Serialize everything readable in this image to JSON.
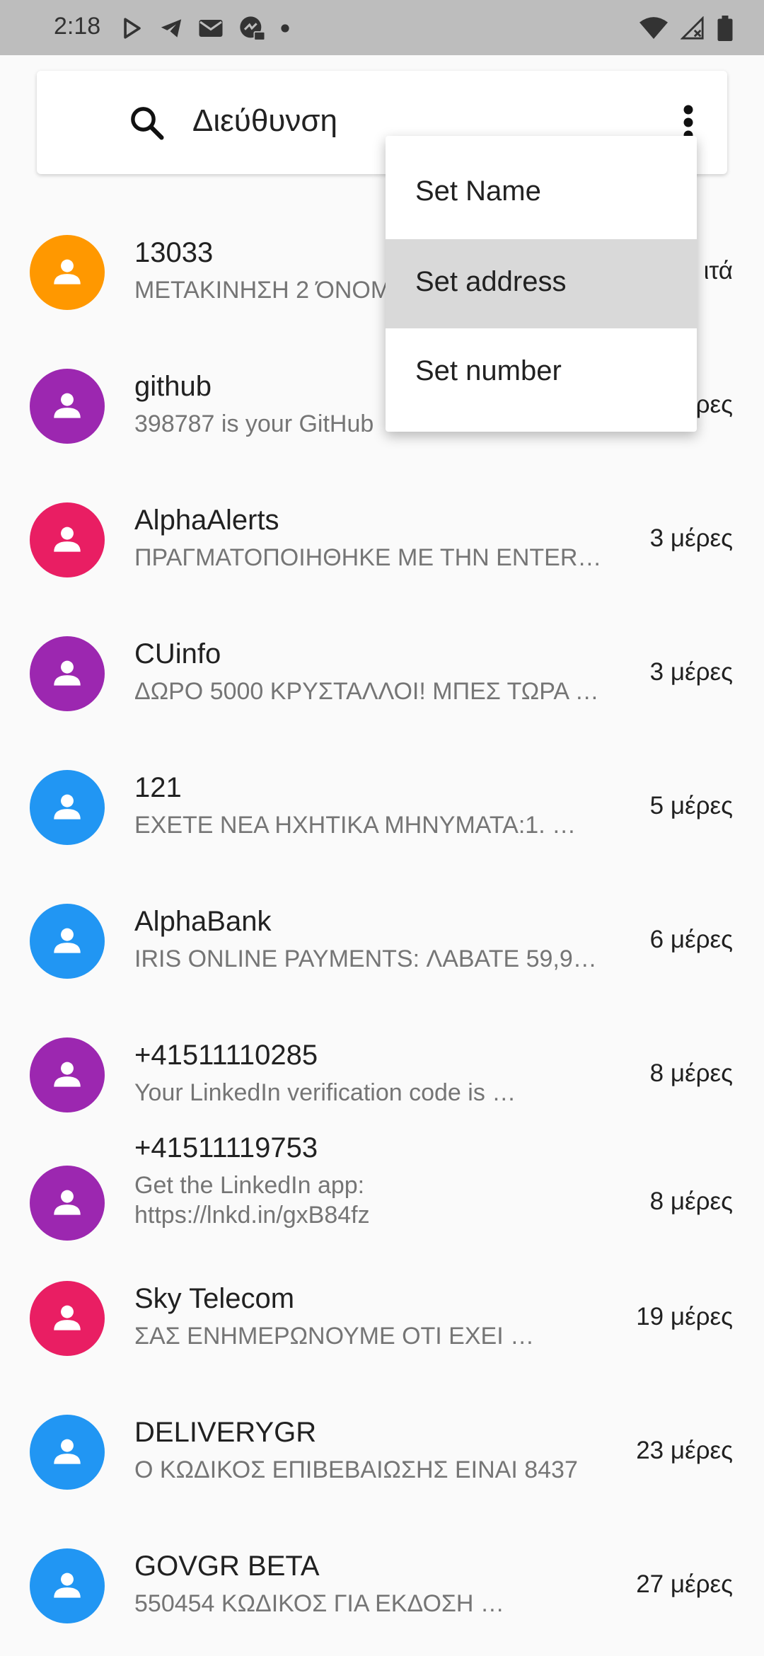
{
  "status_bar": {
    "time": "2:18",
    "icons_left": [
      "play-store-icon",
      "telegram-icon",
      "mail-icon",
      "messenger-icon",
      "dot-icon"
    ],
    "icons_right": [
      "wifi-icon",
      "cell-signal-icon",
      "battery-icon"
    ]
  },
  "search": {
    "text": "Διεύθυνση"
  },
  "menu": {
    "items": [
      {
        "label": "Set Name",
        "selected": false
      },
      {
        "label": "Set address",
        "selected": true
      },
      {
        "label": "Set number",
        "selected": false
      }
    ]
  },
  "colors": {
    "orange": "#ff9800",
    "purple": "#9c27b0",
    "pink": "#e91e63",
    "blue": "#2196f3"
  },
  "conversations": [
    {
      "name": "13033",
      "preview": "ΜΕΤΑΚΙΝΗΣΗ 2 ΌΝΟΜ",
      "time": "ιτά",
      "color": "#ff9800"
    },
    {
      "name": "github",
      "preview": "398787 is your GitHub",
      "time": "ρες",
      "color": "#9c27b0"
    },
    {
      "name": "AlphaAlerts",
      "preview": "ΠΡΑΓΜΑΤΟΠΟΙΗΘΗΚΕ ΜΕ ΤΗΝ ΕΝΤΕR…",
      "time": "3 μέρες",
      "color": "#e91e63"
    },
    {
      "name": "CUinfo",
      "preview": "ΔΩΡΟ 5000 ΚΡΥΣΤΑΛΛΟΙ! ΜΠΕΣ ΤΩΡΑ …",
      "time": "3 μέρες",
      "color": "#9c27b0"
    },
    {
      "name": "121",
      "preview": "ΕΧΕΤΕ ΝΕΑ ΗΧΗΤΙΚΑ ΜΗΝΥΜΑΤΑ:1.  …",
      "time": "5 μέρες",
      "color": "#2196f3"
    },
    {
      "name": "AlphaBank",
      "preview": "IRIS ONLINE PAYMENTS: ΛΑΒΑΤΕ 59,9…",
      "time": "6 μέρες",
      "color": "#2196f3"
    },
    {
      "name": "+41511110285",
      "preview": "Your LinkedIn verification code is …",
      "time": "8 μέρες",
      "color": "#9c27b0"
    },
    {
      "name": "+41511119753",
      "preview": "Get the LinkedIn app:",
      "preview2": "https://lnkd.in/gxB84fz",
      "time": "8 μέρες",
      "color": "#9c27b0"
    },
    {
      "name": "Sky Telecom",
      "preview": "ΣΑΣ ΕΝΗΜΕΡΩΝΟΥΜΕ ΟΤΙ ΕΧΕΙ  …",
      "time": "19 μέρες",
      "color": "#e91e63"
    },
    {
      "name": "DELIVERYGR",
      "preview": "Ο ΚΩΔΙΚΟΣ ΕΠΙΒΕΒΑΙΩΣΗΣ ΕΙΝΑΙ 8437",
      "time": "23 μέρες",
      "color": "#2196f3"
    },
    {
      "name": "GOVGR BETA",
      "preview": "550454 ΚΩΔΙΚΟΣ ΓΙΑ ΕΚΔΟΣΗ …",
      "time": "27 μέρες",
      "color": "#2196f3"
    }
  ]
}
